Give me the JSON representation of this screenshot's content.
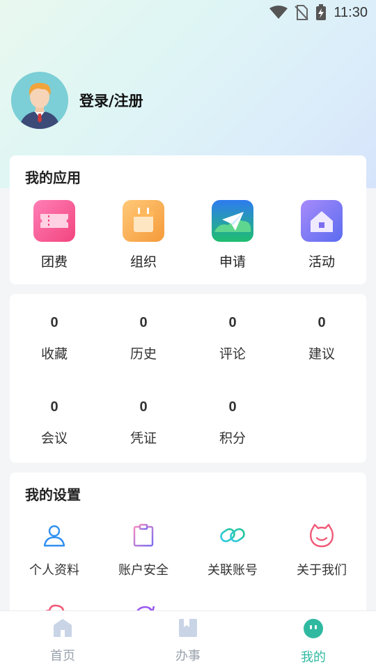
{
  "status_bar": {
    "time": "11:30",
    "icons": [
      "wifi-icon",
      "no-sim-icon",
      "battery-charging-icon"
    ]
  },
  "profile": {
    "login_label": "登录/注册"
  },
  "my_apps": {
    "title": "我的应用",
    "items": [
      {
        "label": "团费",
        "icon": "ticket-icon",
        "color": "#f25c9a"
      },
      {
        "label": "组织",
        "icon": "calendar-icon",
        "color": "#f7a64a"
      },
      {
        "label": "申请",
        "icon": "paper-plane-icon",
        "color": "#1fbe6f"
      },
      {
        "label": "活动",
        "icon": "house-icon",
        "color": "#6b6ef0"
      }
    ]
  },
  "stats": {
    "row1": [
      {
        "value": "0",
        "label": "收藏"
      },
      {
        "value": "0",
        "label": "历史"
      },
      {
        "value": "0",
        "label": "评论"
      },
      {
        "value": "0",
        "label": "建议"
      }
    ],
    "row2": [
      {
        "value": "0",
        "label": "会议"
      },
      {
        "value": "0",
        "label": "凭证"
      },
      {
        "value": "0",
        "label": "积分"
      }
    ]
  },
  "my_settings": {
    "title": "我的设置",
    "items": [
      {
        "label": "个人资料",
        "icon": "user-icon",
        "color": "#2f8ff0"
      },
      {
        "label": "账户安全",
        "icon": "clipboard-icon",
        "color": "#8e6cf0"
      },
      {
        "label": "关联账号",
        "icon": "link-icon",
        "color": "#22c4c4"
      },
      {
        "label": "关于我们",
        "icon": "smile-cat-icon",
        "color": "#f05a78"
      }
    ],
    "partial_items": [
      {
        "icon": "cloud-icon",
        "color": "#f05a78"
      },
      {
        "icon": "refresh-icon",
        "color": "#9b59f0"
      }
    ]
  },
  "tab_bar": {
    "tabs": [
      {
        "label": "首页",
        "icon": "home-icon",
        "active": false
      },
      {
        "label": "办事",
        "icon": "bookmark-book-icon",
        "active": false
      },
      {
        "label": "我的",
        "icon": "face-icon",
        "active": true
      }
    ],
    "active_color": "#2fb9a0"
  }
}
